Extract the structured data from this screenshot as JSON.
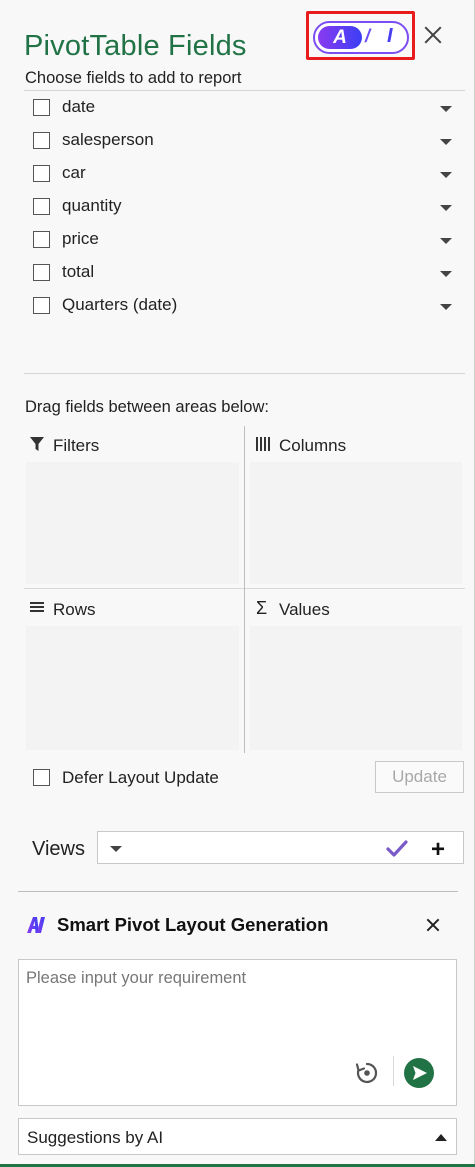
{
  "panel": {
    "title": "PivotTable Fields",
    "ai_toggle": {
      "left": "A",
      "separator": "/",
      "right": "I"
    },
    "choose_label": "Choose fields to add to report"
  },
  "fields": [
    {
      "label": "date",
      "checked": false
    },
    {
      "label": "salesperson",
      "checked": false
    },
    {
      "label": "car",
      "checked": false
    },
    {
      "label": "quantity",
      "checked": false
    },
    {
      "label": "price",
      "checked": false
    },
    {
      "label": "total",
      "checked": false
    },
    {
      "label": "Quarters (date)",
      "checked": false
    }
  ],
  "areas": {
    "hint": "Drag fields between areas below:",
    "filters": "Filters",
    "columns": "Columns",
    "rows": "Rows",
    "values": "Values"
  },
  "defer": {
    "label": "Defer Layout Update",
    "update_button": "Update"
  },
  "views": {
    "label": "Views"
  },
  "ai_panel": {
    "title": "Smart Pivot Layout Generation",
    "placeholder": "Please input your requirement",
    "suggestions_label": "Suggestions by AI"
  },
  "colors": {
    "accent": "#217346",
    "ai_gradient_start": "#8a3cf0",
    "ai_gradient_end": "#3b3ef5",
    "highlight_frame": "#e81c1c"
  }
}
